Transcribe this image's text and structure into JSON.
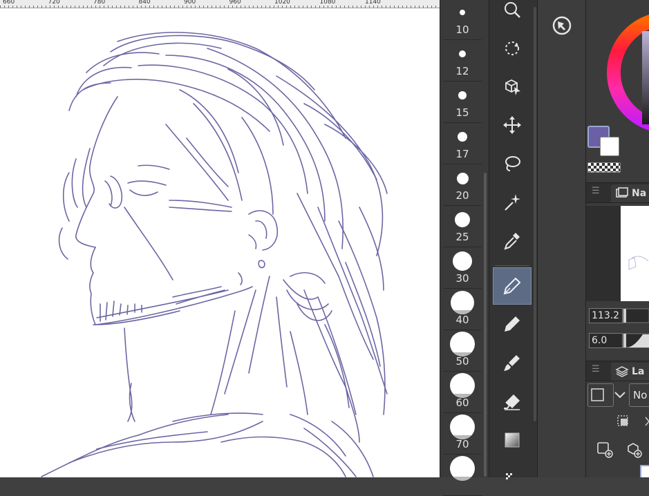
{
  "ruler": {
    "labels": [
      "660",
      "720",
      "780",
      "840",
      "900",
      "960",
      "1020",
      "1080",
      "1140"
    ]
  },
  "canvas": {
    "stroke_color": "#6b66a3",
    "background": "#ffffff"
  },
  "brush_sizes": [
    {
      "label": "10",
      "dot": 8
    },
    {
      "label": "12",
      "dot": 10
    },
    {
      "label": "15",
      "dot": 12
    },
    {
      "label": "17",
      "dot": 14
    },
    {
      "label": "20",
      "dot": 17
    },
    {
      "label": "25",
      "dot": 22
    },
    {
      "label": "30",
      "dot": 28
    },
    {
      "label": "40",
      "dot": 34
    },
    {
      "label": "50",
      "dot": 36
    },
    {
      "label": "60",
      "dot": 36
    },
    {
      "label": "70",
      "dot": 36
    },
    {
      "label": "",
      "dot": 36
    }
  ],
  "tools": [
    {
      "name": "zoom-icon"
    },
    {
      "name": "rotate-icon"
    },
    {
      "name": "object-select-icon"
    },
    {
      "name": "move-icon"
    },
    {
      "name": "lasso-icon"
    },
    {
      "name": "magic-wand-icon"
    },
    {
      "name": "eyedropper-icon"
    },
    {
      "name": "pen-icon",
      "active": true
    },
    {
      "name": "pencil-icon"
    },
    {
      "name": "brush-icon"
    },
    {
      "name": "eraser-icon"
    },
    {
      "name": "fill-icon"
    },
    {
      "name": "gradient-icon"
    }
  ],
  "colors": {
    "main": "#6b5fa6",
    "sub": "#ffffff"
  },
  "navigator": {
    "tab_label": "Na"
  },
  "brush_size_value": "113.2",
  "opacity_value": "6.0",
  "layer": {
    "tab_label": "La",
    "blend_mode": "No"
  }
}
